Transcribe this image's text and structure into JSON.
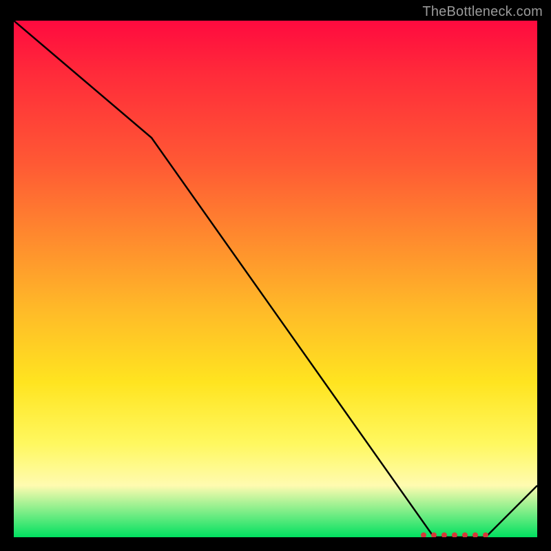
{
  "watermark": "TheBottleneck.com",
  "chart_data": {
    "type": "line",
    "title": "",
    "xlabel": "",
    "ylabel": "",
    "xlim": [
      0,
      100
    ],
    "ylim": [
      0,
      100
    ],
    "grid": false,
    "legend": false,
    "annotations": [],
    "series": [
      {
        "name": "curve",
        "x": [
          0,
          26,
          80,
          85,
          90,
          100
        ],
        "y": [
          100,
          77,
          0,
          0,
          0,
          10
        ]
      }
    ],
    "markers": {
      "name": "optimum-cluster",
      "x": [
        78,
        80,
        82,
        84,
        86,
        88,
        90
      ],
      "y": [
        0,
        0,
        0,
        0,
        0,
        0,
        0
      ]
    }
  },
  "colors": {
    "curve": "#000000",
    "marker_fill": "#d43a3a",
    "marker_stroke": "#a02020",
    "background_top": "#ff0a3f",
    "background_bottom": "#00e060"
  }
}
